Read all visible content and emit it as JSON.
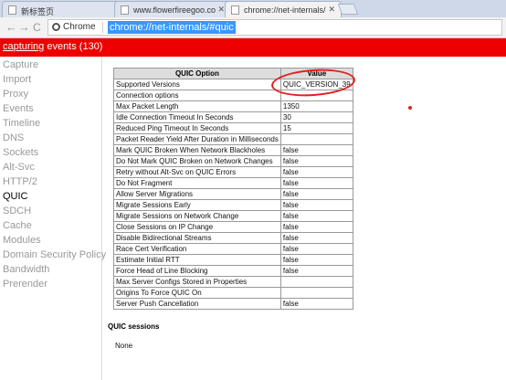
{
  "tabs": [
    {
      "label": "新标签页",
      "active": false
    },
    {
      "label": "www.flowerfireegoo.co",
      "active": false
    },
    {
      "label": "chrome://net-internals/",
      "active": true
    }
  ],
  "toolbar": {
    "back": "←",
    "forward": "→",
    "reload": "C",
    "chip": "Chrome",
    "url": "chrome://net-internals/#quic"
  },
  "status": {
    "capturing": "capturing",
    "events": "events (130)"
  },
  "sidebar": {
    "items": [
      {
        "label": "Capture"
      },
      {
        "label": "Import"
      },
      {
        "label": "Proxy"
      },
      {
        "label": "Events"
      },
      {
        "label": "Timeline"
      },
      {
        "label": "DNS"
      },
      {
        "label": "Sockets"
      },
      {
        "label": "Alt-Svc"
      },
      {
        "label": "HTTP/2"
      },
      {
        "label": "QUIC",
        "selected": true
      },
      {
        "label": "SDCH"
      },
      {
        "label": "Cache"
      },
      {
        "label": "Modules"
      },
      {
        "label": "Domain Security Policy"
      },
      {
        "label": "Bandwidth"
      },
      {
        "label": "Prerender"
      }
    ]
  },
  "quic_table": {
    "headers": [
      "QUIC Option",
      "Value"
    ],
    "rows": [
      [
        "Supported Versions",
        "QUIC_VERSION_39"
      ],
      [
        "Connection options",
        ""
      ],
      [
        "Max Packet Length",
        "1350"
      ],
      [
        "Idle Connection Timeout In Seconds",
        "30"
      ],
      [
        "Reduced Ping Timeout In Seconds",
        "15"
      ],
      [
        "Packet Reader Yield After Duration in Milliseconds",
        ""
      ],
      [
        "Mark QUIC Broken When Network Blackholes",
        "false"
      ],
      [
        "Do Not Mark QUIC Broken on Network Changes",
        "false"
      ],
      [
        "Retry without Alt-Svc on QUIC Errors",
        "false"
      ],
      [
        "Do Not Fragment",
        "false"
      ],
      [
        "Allow Server Migrations",
        "false"
      ],
      [
        "Migrate Sessions Early",
        "false"
      ],
      [
        "Migrate Sessions on Network Change",
        "false"
      ],
      [
        "Close Sessions on IP Change",
        "false"
      ],
      [
        "Disable Bidirectional Streams",
        "false"
      ],
      [
        "Race Cert Verification",
        "false"
      ],
      [
        "Estimate Initial RTT",
        "false"
      ],
      [
        "Force Head of Line Blocking",
        "false"
      ],
      [
        "Max Server Configs Stored in Properties",
        ""
      ],
      [
        "Origins To Force QUIC On",
        ""
      ],
      [
        "Server Push Cancellation",
        "false"
      ]
    ]
  },
  "sessions": {
    "title": "QUIC sessions",
    "value": "None"
  },
  "colors": {
    "status_bar": "#ee0000",
    "annotation": "#e02020",
    "url_highlight": "#3399ff"
  }
}
